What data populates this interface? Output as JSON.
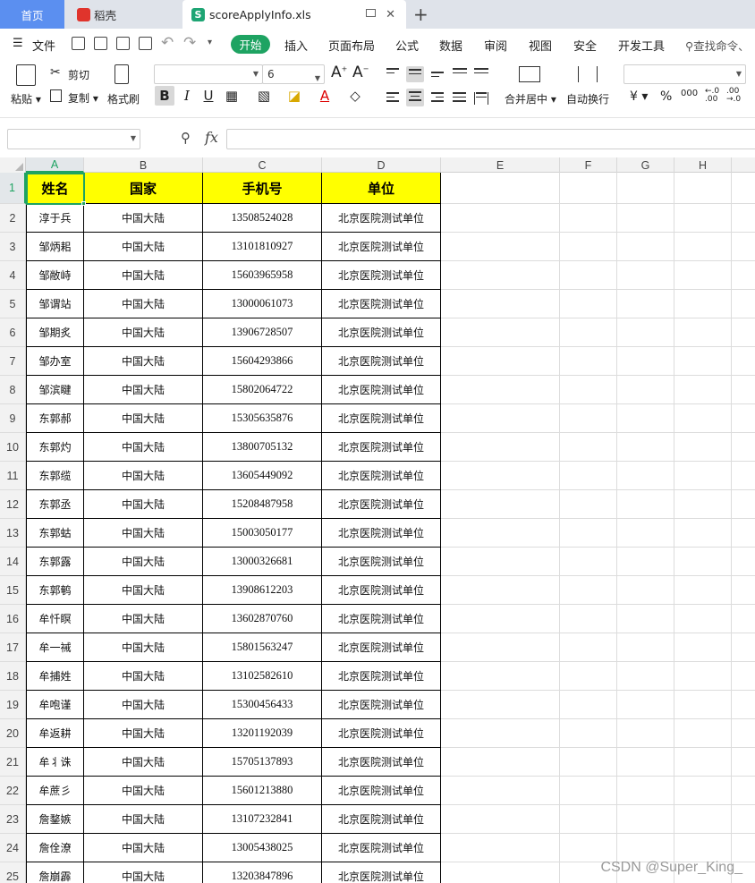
{
  "tabs": {
    "home": "首页",
    "docer": "稻壳",
    "file": "scoreApplyInfo.xls"
  },
  "menu": {
    "file_label": "文件",
    "items": [
      "开始",
      "插入",
      "页面布局",
      "公式",
      "数据",
      "审阅",
      "视图",
      "安全",
      "开发工具"
    ],
    "search_label": "查找命令、"
  },
  "ribbon": {
    "paste": "粘贴",
    "cut": "剪切",
    "copy": "复制",
    "format_painter": "格式刷",
    "font_name": "",
    "font_size": "6",
    "bold": "B",
    "italic": "I",
    "underline": "U",
    "merge_center": "合并居中",
    "wrap_text": "自动换行",
    "currency": "¥",
    "percent": "%",
    "thousands": "000",
    "number_format": ""
  },
  "formula_bar": {
    "name_box": "",
    "fx_label": "fx",
    "content": ""
  },
  "sheet": {
    "columns": [
      "A",
      "B",
      "C",
      "D",
      "E",
      "F",
      "G",
      "H"
    ],
    "selected_column": "A",
    "selected_row": 1,
    "headers": [
      "姓名",
      "国家",
      "手机号",
      "单位"
    ],
    "rows": [
      [
        "淳于兵",
        "中国大陆",
        "13508524028",
        "北京医院测试单位"
      ],
      [
        "邹炳耜",
        "中国大陆",
        "13101810927",
        "北京医院测试单位"
      ],
      [
        "邹敝峙",
        "中国大陆",
        "15603965958",
        "北京医院测试单位"
      ],
      [
        "邹谓站",
        "中国大陆",
        "13000061073",
        "北京医院测试单位"
      ],
      [
        "邹期炙",
        "中国大陆",
        "13906728507",
        "北京医院测试单位"
      ],
      [
        "邹办室",
        "中国大陆",
        "15604293866",
        "北京医院测试单位"
      ],
      [
        "邹滨睷",
        "中国大陆",
        "15802064722",
        "北京医院测试单位"
      ],
      [
        "东郭郝",
        "中国大陆",
        "15305635876",
        "北京医院测试单位"
      ],
      [
        "东郭灼",
        "中国大陆",
        "13800705132",
        "北京医院测试单位"
      ],
      [
        "东郭缆",
        "中国大陆",
        "13605449092",
        "北京医院测试单位"
      ],
      [
        "东郭丞",
        "中国大陆",
        "15208487958",
        "北京医院测试单位"
      ],
      [
        "东郭蛄",
        "中国大陆",
        "15003050177",
        "北京医院测试单位"
      ],
      [
        "东郭露",
        "中国大陆",
        "13000326681",
        "北京医院测试单位"
      ],
      [
        "东郭鹌",
        "中国大陆",
        "13908612203",
        "北京医院测试单位"
      ],
      [
        "牟忏瞑",
        "中国大陆",
        "13602870760",
        "北京医院测试单位"
      ],
      [
        "牟一祴",
        "中国大陆",
        "15801563247",
        "北京医院测试单位"
      ],
      [
        "牟捕姓",
        "中国大陆",
        "13102582610",
        "北京医院测试单位"
      ],
      [
        "牟咆谨",
        "中国大陆",
        "15300456433",
        "北京医院测试单位"
      ],
      [
        "牟返耕",
        "中国大陆",
        "13201192039",
        "北京医院测试单位"
      ],
      [
        "牟丬诛",
        "中国大陆",
        "15705137893",
        "北京医院测试单位"
      ],
      [
        "牟蔗彡",
        "中国大陆",
        "15601213880",
        "北京医院测试单位"
      ],
      [
        "詹鍪嫉",
        "中国大陆",
        "13107232841",
        "北京医院测试单位"
      ],
      [
        "詹佺潦",
        "中国大陆",
        "13005438025",
        "北京医院测试单位"
      ],
      [
        "詹崩霹",
        "中国大陆",
        "13203847896",
        "北京医院测试单位"
      ]
    ]
  },
  "colors": {
    "accent": "#1ea362",
    "header_fill": "#ffff00",
    "home_tab": "#5b8ff0"
  },
  "watermark": "CSDN @Super_King_"
}
